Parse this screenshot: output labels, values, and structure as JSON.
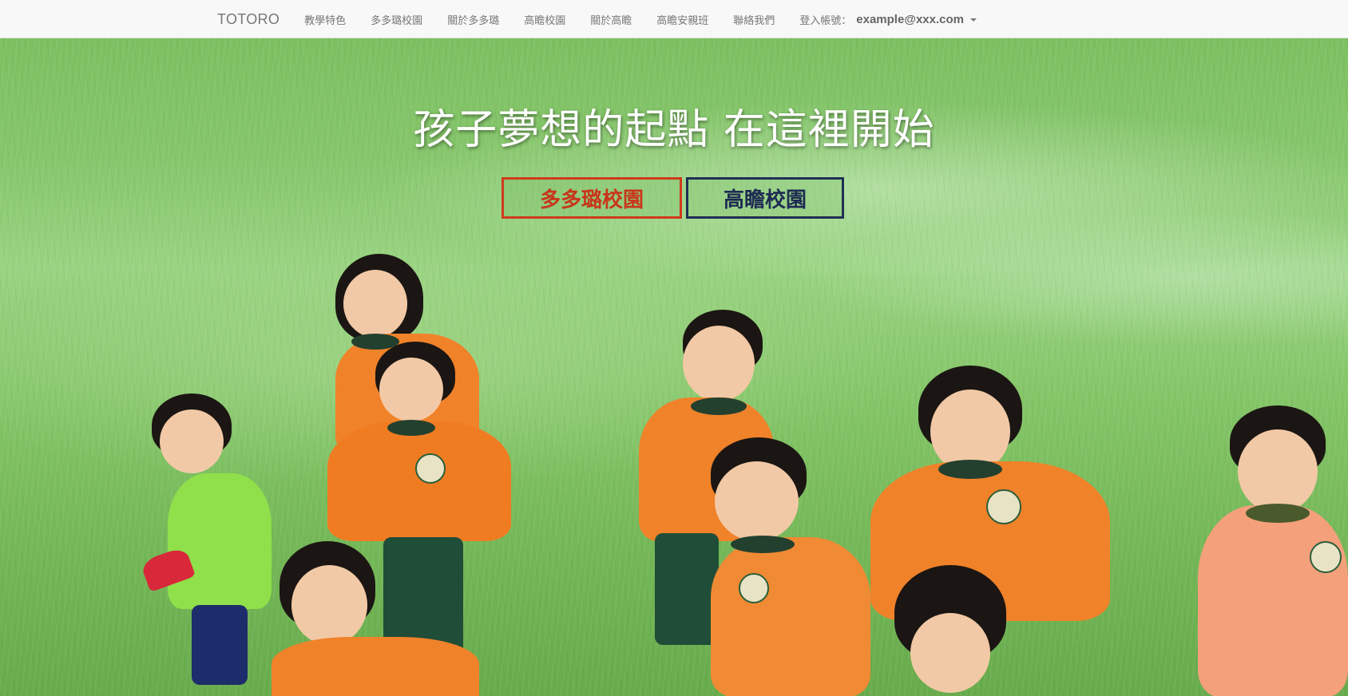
{
  "navbar": {
    "brand": "TOTORO",
    "items": [
      {
        "label": "教學特色"
      },
      {
        "label": "多多璐校園"
      },
      {
        "label": "關於多多璐"
      },
      {
        "label": "高瞻校園"
      },
      {
        "label": "關於高瞻"
      },
      {
        "label": "高瞻安親班"
      },
      {
        "label": "聯絡我們"
      }
    ],
    "account_label": "登入帳號：",
    "account_email": "example@xxx.com",
    "account_icon": "caret-down-icon"
  },
  "hero": {
    "headline": "孩子夢想的起點 在這裡開始",
    "buttons": [
      {
        "label": "多多璐校園",
        "color": "#d03a1c"
      },
      {
        "label": "高瞻校園",
        "color": "#1f2f55"
      }
    ],
    "background": "children-running-on-grass-photo"
  },
  "colors": {
    "navbar_bg": "#f8f8f8",
    "nav_text": "#777777",
    "grass": "#86c66b",
    "uniform_orange": "#f0822a"
  }
}
